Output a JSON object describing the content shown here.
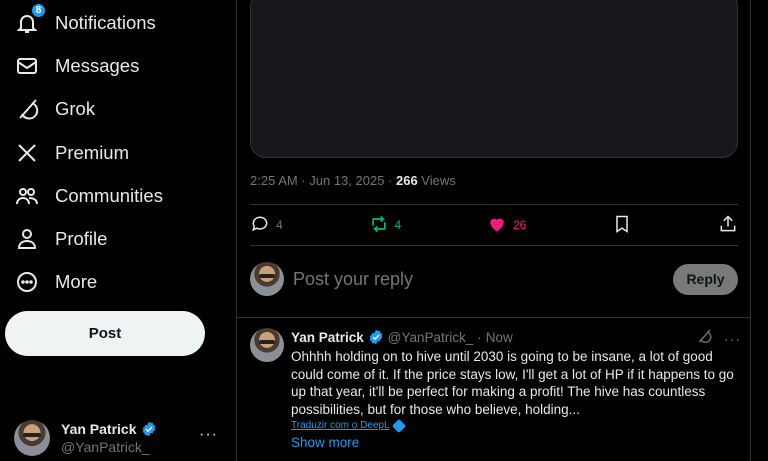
{
  "sidebar": {
    "items": [
      {
        "label": "Notifications",
        "icon": "bell-icon",
        "badge": "8"
      },
      {
        "label": "Messages",
        "icon": "envelope-icon"
      },
      {
        "label": "Grok",
        "icon": "grok-icon"
      },
      {
        "label": "Premium",
        "icon": "x-logo-icon"
      },
      {
        "label": "Communities",
        "icon": "people-icon"
      },
      {
        "label": "Profile",
        "icon": "person-icon"
      },
      {
        "label": "More",
        "icon": "more-circle-icon"
      }
    ],
    "post_label": "Post",
    "account": {
      "name": "Yan Patrick",
      "handle": "@YanPatrick_",
      "more": "···"
    }
  },
  "tweet": {
    "time": "2:25 AM · Jun 13, 2025 · ",
    "views_count": "266",
    "views_label": " Views",
    "replies": "4",
    "reposts": "4",
    "likes": "26"
  },
  "reply_box": {
    "placeholder": "Post your reply",
    "button": "Reply"
  },
  "reply": {
    "name": "Yan Patrick",
    "handle": "@YanPatrick_",
    "dot": "·",
    "time": "Now",
    "text": "Ohhhh holding on to hive until 2030 is going to be insane, a lot of good could come of it. If the price stays low, I'll get a lot of HP if it happens to go up that year, it'll be perfect for making a profit! The hive has countless possibilities, but for those who believe, holding...",
    "translate": "Traduzir com o DeepL",
    "show_more": "Show more",
    "more": "···"
  },
  "colors": {
    "accent": "#1d9bf0",
    "repost": "#00ba7c",
    "like": "#f91880",
    "background": "#000000"
  }
}
